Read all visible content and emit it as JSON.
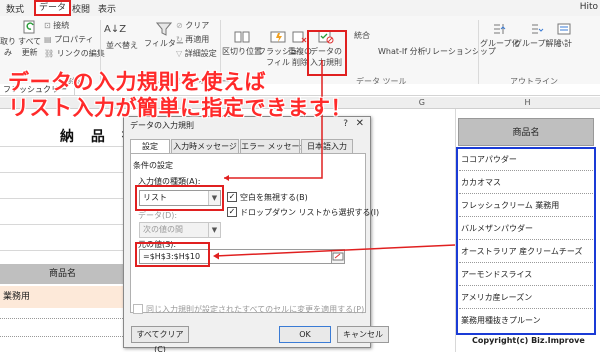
{
  "ribbon_tabs": [
    {
      "label": "数式"
    },
    {
      "label": "データ",
      "active": true
    },
    {
      "label": "校閲"
    },
    {
      "label": "表示"
    }
  ],
  "user_hint": "Hito",
  "ribbon": {
    "connections": [
      "接続",
      "プロパティ",
      "リンクの編集"
    ],
    "refresh_all_l1": "すべて",
    "refresh_all_l2": "更新",
    "left_stub_l1": "取り",
    "left_stub_l2": "み",
    "connections_group": "接続",
    "sort_label": "並べ替え",
    "filter_label": "フィルター",
    "filter_options": [
      "クリア",
      "再適用",
      "詳細設定"
    ],
    "sort_filter_group": "並べ替えとフィルター",
    "text_to_columns": "区切り位置",
    "flash_fill_l1": "フラッシュ",
    "flash_fill_l2": "フィル",
    "remove_dup_l1": "重複の",
    "remove_dup_l2": "削除",
    "data_validation_l1": "データの",
    "data_validation_l2": "入力規則",
    "consolidate": "統合",
    "what_if": "What-If 分析",
    "relationships": "リレーションシップ",
    "data_tools_group": "データ ツール",
    "group_btn": "グループ化",
    "ungroup_btn": "グループ解除",
    "subtotal_btn": "小計",
    "outline_group": "アウトライン"
  },
  "headline": {
    "line1": "データの入力規則を使えば",
    "line2": "リスト入力が簡単に指定できます！"
  },
  "name_box": "フレッシュクリー",
  "columns": {
    "g": "G",
    "h": "H"
  },
  "left_sheet": {
    "title": "納 品 書",
    "header": "商品名",
    "cell_value": "業務用"
  },
  "dialog": {
    "title": "データの入力規則",
    "help": "?",
    "close": "✕",
    "tabs": [
      "設定",
      "入力時メッセージ",
      "エラー メッセージ",
      "日本語入力"
    ],
    "section": "条件の設定",
    "allow_label": "入力値の種類(A):",
    "allow_value": "リスト",
    "ignore_blank": "空白を無視する(B)",
    "in_cell_dropdown": "ドロップダウン リストから選択する(I)",
    "data_label": "データ(D):",
    "data_value": "次の値の間",
    "source_label": "元の値(S):",
    "source_value": "=$H$3:$H$10",
    "apply_all": "同じ入力規則が設定されたすべてのセルに変更を適用する(P)",
    "clear_all": "すべてクリア(C)",
    "ok": "OK",
    "cancel": "キャンセル"
  },
  "product_list": {
    "header": "商品名",
    "items": [
      "ココアパウダー",
      "カカオマス",
      "フレッシュクリーム 業務用",
      "バルメザンパウダー",
      "オーストラリア 産クリームチーズ",
      "アーモンドスライス",
      "アメリカ産レーズン",
      "業務用種抜きプルーン"
    ]
  },
  "copyright": "Copyright(c) Biz.Improve",
  "colors": {
    "accent_red": "#e02020",
    "list_blue": "#1a3bd6",
    "headline_red": "#ff2a2a"
  }
}
